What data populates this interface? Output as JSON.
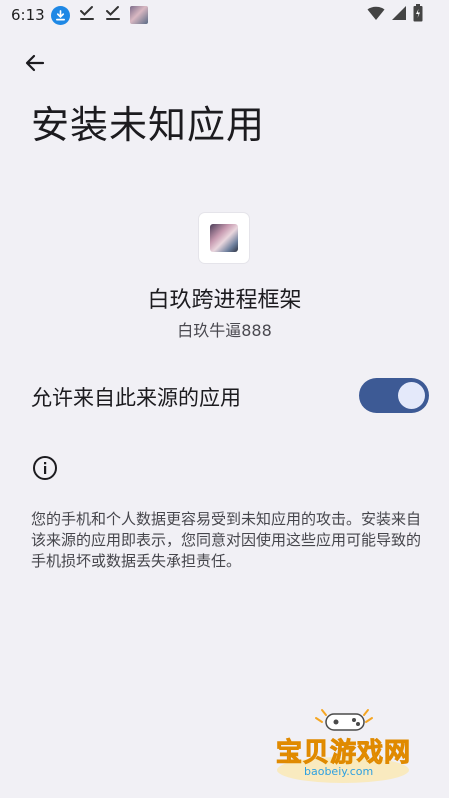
{
  "status_bar": {
    "time": "6:13",
    "left_icons": [
      "download-icon",
      "check-icon",
      "check-icon",
      "app-thumbnail-icon"
    ],
    "right_icons": [
      "wifi-icon",
      "signal-icon",
      "battery-icon"
    ]
  },
  "header": {
    "back_icon": "arrow-back-icon",
    "title": "安装未知应用"
  },
  "app": {
    "name": "白玖跨进程框架",
    "source": "白玖牛逼888"
  },
  "setting": {
    "label": "允许来自此来源的应用",
    "enabled": true,
    "accent_color": "#3D5A95"
  },
  "info": {
    "icon": "info-icon",
    "warning": "您的手机和个人数据更容易受到未知应用的攻击。安装来自该来源的应用即表示，您同意对因使用这些应用可能导致的手机损坏或数据丢失承担责任。"
  },
  "watermark": {
    "text": "宝贝游戏网",
    "url": "baobeiy.com"
  }
}
